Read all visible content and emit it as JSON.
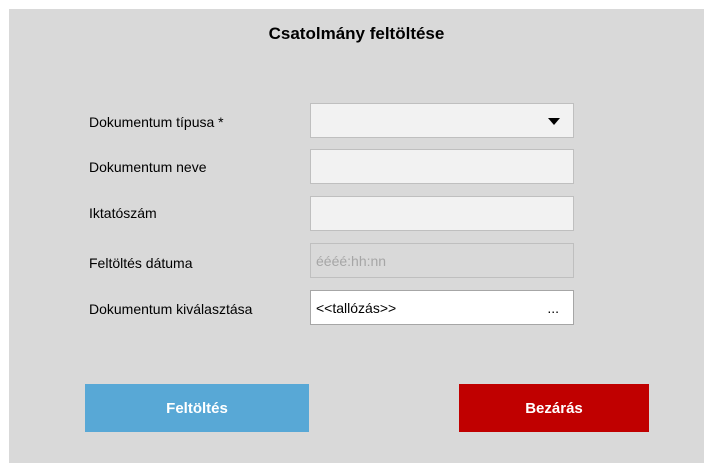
{
  "dialog": {
    "title": "Csatolmány feltöltése"
  },
  "form": {
    "document_type": {
      "label": "Dokumentum típusa *",
      "value": ""
    },
    "document_name": {
      "label": "Dokumentum neve",
      "value": ""
    },
    "reference_number": {
      "label": "Iktatószám",
      "value": ""
    },
    "upload_date": {
      "label": "Feltöltés dátuma",
      "placeholder": "éééé:hh:nn"
    },
    "document_select": {
      "label": "Dokumentum kiválasztása",
      "value": "<<tallózás>>",
      "browse": "..."
    }
  },
  "buttons": {
    "upload": "Feltöltés",
    "close": "Bezárás"
  },
  "colors": {
    "upload_button": "#58a8d6",
    "close_button": "#c00000"
  },
  "icons": {
    "dropdown": "chevron-down-icon"
  }
}
